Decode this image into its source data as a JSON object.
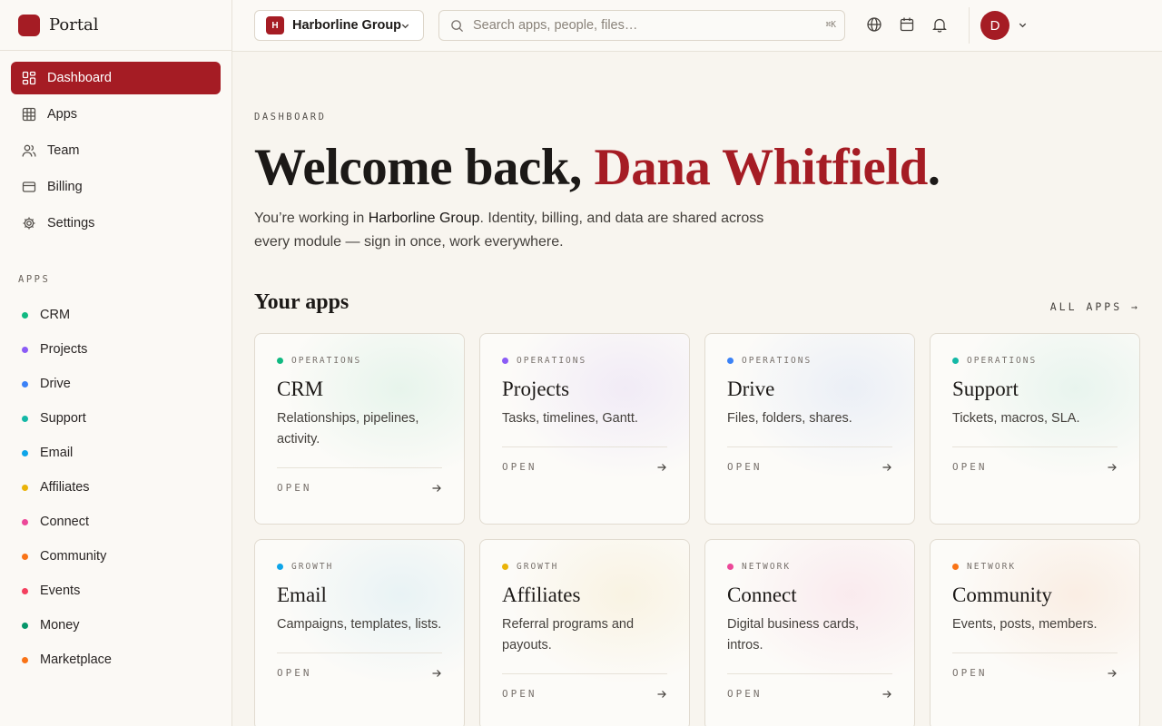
{
  "brand": {
    "name": "Portal",
    "accent": "#a51c24"
  },
  "nav": [
    {
      "label": "Dashboard",
      "icon": "dashboard-icon",
      "active": true
    },
    {
      "label": "Apps",
      "icon": "grid-icon"
    },
    {
      "label": "Team",
      "icon": "users-icon"
    },
    {
      "label": "Billing",
      "icon": "credit-card-icon"
    },
    {
      "label": "Settings",
      "icon": "gear-icon"
    }
  ],
  "apps_heading": "APPS",
  "sidebar_apps": [
    {
      "label": "CRM",
      "color": "#10b981"
    },
    {
      "label": "Projects",
      "color": "#8b5cf6"
    },
    {
      "label": "Drive",
      "color": "#3b82f6"
    },
    {
      "label": "Support",
      "color": "#14b8a6"
    },
    {
      "label": "Email",
      "color": "#0ea5e9"
    },
    {
      "label": "Affiliates",
      "color": "#eab308"
    },
    {
      "label": "Connect",
      "color": "#ec4899"
    },
    {
      "label": "Community",
      "color": "#f97316"
    },
    {
      "label": "Events",
      "color": "#f43f5e"
    },
    {
      "label": "Money",
      "color": "#059669"
    },
    {
      "label": "Marketplace",
      "color": "#f97316"
    }
  ],
  "topbar": {
    "org_badge": "H",
    "org_name": "Harborline Group",
    "search_placeholder": "Search apps, people, files…",
    "search_shortcut": "⌘K",
    "avatar_initial": "D"
  },
  "main": {
    "eyebrow": "DASHBOARD",
    "welcome_prefix": "Welcome back, ",
    "user_name": "Dana Whitfield",
    "welcome_suffix": ".",
    "intro_prefix": "You’re working in ",
    "intro_org": "Harborline Group",
    "intro_suffix": ". Identity, billing, and data are shared across every module — sign in once, work everywhere.",
    "apps_title": "Your apps",
    "all_apps_label": "ALL APPS →"
  },
  "cards": [
    {
      "category": "OPERATIONS",
      "title": "CRM",
      "desc": "Relationships, pipelines, activity.",
      "color": "#10b981",
      "glow": "#d6efe2",
      "open": "OPEN"
    },
    {
      "category": "OPERATIONS",
      "title": "Projects",
      "desc": "Tasks, timelines, Gantt.",
      "color": "#8b5cf6",
      "glow": "#e8def5",
      "open": "OPEN"
    },
    {
      "category": "OPERATIONS",
      "title": "Drive",
      "desc": "Files, folders, shares.",
      "color": "#3b82f6",
      "glow": "#dde5f5",
      "open": "OPEN"
    },
    {
      "category": "OPERATIONS",
      "title": "Support",
      "desc": "Tickets, macros, SLA.",
      "color": "#14b8a6",
      "glow": "#d8efe6",
      "open": "OPEN"
    },
    {
      "category": "GROWTH",
      "title": "Email",
      "desc": "Campaigns, templates, lists.",
      "color": "#0ea5e9",
      "glow": "#d9ecf2",
      "open": "OPEN"
    },
    {
      "category": "GROWTH",
      "title": "Affiliates",
      "desc": "Referral programs and payouts.",
      "color": "#eab308",
      "glow": "#f6ecd1",
      "open": "OPEN"
    },
    {
      "category": "NETWORK",
      "title": "Connect",
      "desc": "Digital business cards, intros.",
      "color": "#ec4899",
      "glow": "#f7dde6",
      "open": "OPEN"
    },
    {
      "category": "NETWORK",
      "title": "Community",
      "desc": "Events, posts, members.",
      "color": "#f97316",
      "glow": "#f8e3d3",
      "open": "OPEN"
    }
  ]
}
